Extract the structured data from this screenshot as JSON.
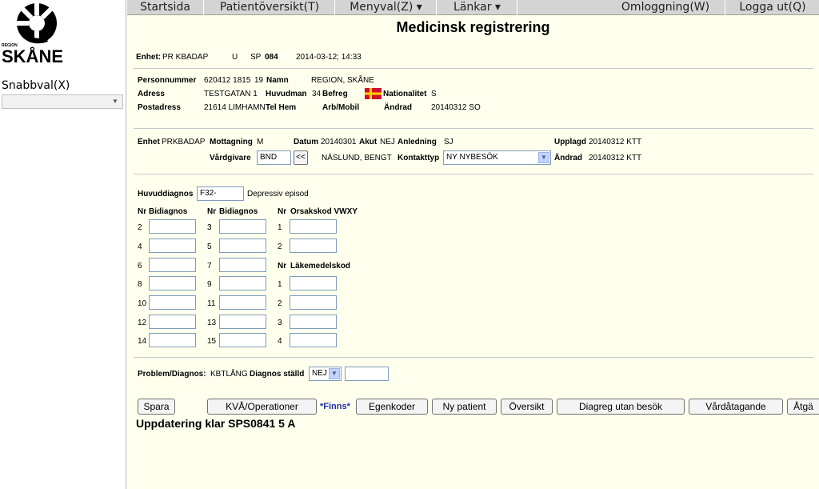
{
  "sidebar": {
    "logo_region": "REGION",
    "logo_name": "SKÅNE",
    "snabbval_label": "Snabbval(X)",
    "snabbval_value": ""
  },
  "menu": {
    "items": [
      "Startsida",
      "Patientöversikt(T)",
      "Menyval(Z) ▾",
      "Länkar ▾",
      "Omloggning(W)",
      "Logga ut(Q)"
    ]
  },
  "page": {
    "title": "Medicinsk registrering"
  },
  "header": {
    "enhet_label": "Enhet:",
    "enhet_value": "PR KBADAP",
    "u_label": "U",
    "sp_label": "SP",
    "sp_value": "084",
    "datetime": "2014-03-12; 14:33"
  },
  "patient": {
    "personnummer_label": "Personnummer",
    "personnummer_value": "620412 1815",
    "personnummer_num": "19",
    "namn_label": "Namn",
    "namn_value": "REGION, SKÅNE",
    "adress_label": "Adress",
    "adress_value": "TESTGATAN 1",
    "huvudman_label": "Huvudman",
    "huvudman_value": "34",
    "befreg_label": "Befreg",
    "nationalitet_label": "Nationalitet",
    "nationalitet_value": "S",
    "postadress_label": "Postadress",
    "postadress_value": "21614 LIMHAMN",
    "telhem_label": "Tel Hem",
    "arbmobil_label": "Arb/Mobil",
    "andrad_label": "Ändrad",
    "andrad_value": "20140312 SO"
  },
  "visit": {
    "enhet_label": "Enhet",
    "enhet_value": "PRKBADAP",
    "mottagning_label": "Mottagning",
    "mottagning_value": "M",
    "datum_label": "Datum",
    "datum_value": "20140301",
    "akut_label": "Akut",
    "akut_value": "NEJ",
    "anledning_label": "Anledning",
    "anledning_value": "SJ",
    "upplagd_label": "Upplagd",
    "upplagd_value": "20140312 KTT",
    "vardgivare_label": "Vårdgivare",
    "vardgivare_value": "BND",
    "back_btn": "<<",
    "vardgivare_name": "NÄSLUND, BENGT",
    "kontakttyp_label": "Kontakttyp",
    "kontakttyp_value": "NY NYBESÖK",
    "andrad_label": "Ändrad",
    "andrad_value": "20140312 KTT"
  },
  "diagnosis": {
    "huvuddiagnos_label": "Huvuddiagnos",
    "huvuddiagnos_value": "F32-",
    "huvuddiagnos_text": "Depressiv episod",
    "nr_label": "Nr",
    "bidiagnos_label": "Bidiagnos",
    "orsakskod_label": "Orsakskod VWXY",
    "lakemedelskod_label": "Läkemedelskod",
    "col1_nrs": [
      "2",
      "4",
      "6",
      "8",
      "10",
      "12",
      "14"
    ],
    "col2_nrs": [
      "3",
      "5",
      "7",
      "9",
      "11",
      "13",
      "15"
    ],
    "orsak_nrs": [
      "1",
      "2"
    ],
    "lakemedel_nrs": [
      "1",
      "2",
      "3",
      "4"
    ]
  },
  "problem": {
    "label": "Problem/Diagnos:",
    "value": "KBTLÅNG",
    "diagnos_stalld_label": "Diagnos ställd",
    "diagnos_stalld_value": "NEJ"
  },
  "buttons": {
    "spara": "Spara",
    "kva": "KVÅ/Operationer",
    "finns": "*Finns*",
    "egenkoder": "Egenkoder",
    "ny_patient": "Ny patient",
    "oversikt": "Översikt",
    "diagreg": "Diagreg utan besök",
    "vardatagande": "Vårdåtagande",
    "atga": "Åtgä"
  },
  "status": {
    "message": "Uppdatering klar SPS0841 5 A"
  },
  "colors": {
    "main_bg": "#ffffee",
    "menubar_bg": "#d4d4d4",
    "input_border": "#7f9db9",
    "finns_color": "#1a2fa0"
  }
}
